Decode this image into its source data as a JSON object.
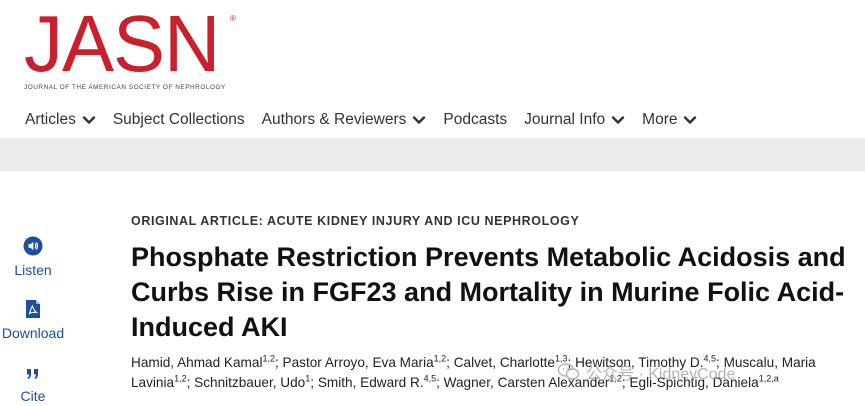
{
  "brand": {
    "logo_text": "JASN",
    "registered": "®",
    "subtitle": "JOURNAL OF THE AMERICAN SOCIETY OF NEPHROLOGY",
    "color": "#c8202c"
  },
  "nav": {
    "items": [
      {
        "label": "Articles",
        "has_dropdown": true
      },
      {
        "label": "Subject Collections",
        "has_dropdown": false
      },
      {
        "label": "Authors & Reviewers",
        "has_dropdown": true
      },
      {
        "label": "Podcasts",
        "has_dropdown": false
      },
      {
        "label": "Journal Info",
        "has_dropdown": true
      },
      {
        "label": "More",
        "has_dropdown": true
      }
    ]
  },
  "tools": {
    "listen": {
      "label": "Listen",
      "icon": "speaker-icon"
    },
    "download": {
      "label": "Download",
      "icon": "pdf-icon"
    },
    "cite": {
      "label": "Cite",
      "icon": "quote-icon"
    },
    "color": "#1c4f9c"
  },
  "article": {
    "category": "ORIGINAL ARTICLE: ACUTE KIDNEY INJURY AND ICU NEPHROLOGY",
    "title": "Phosphate Restriction Prevents Metabolic Acidosis and Curbs Rise in FGF23 and Mortality in Murine Folic Acid-Induced AKI",
    "authors": [
      {
        "name": "Hamid, Ahmad Kamal",
        "aff": "1,2"
      },
      {
        "name": "Pastor Arroyo, Eva Maria",
        "aff": "1,2"
      },
      {
        "name": "Calvet, Charlotte",
        "aff": "1,3"
      },
      {
        "name": "Hewitson, Timothy D.",
        "aff": "4,5"
      },
      {
        "name": "Muscalu, Maria Lavinia",
        "aff": "1,2"
      },
      {
        "name": "Schnitzbauer, Udo",
        "aff": "1"
      },
      {
        "name": "Smith, Edward R.",
        "aff": "4,5"
      },
      {
        "name": "Wagner, Carsten Alexander",
        "aff": "1,2"
      },
      {
        "name": "Egli-Spichtig, Daniela",
        "aff": "1,2,a"
      }
    ]
  },
  "watermark": {
    "text": "公众号 · KidneyCode"
  }
}
